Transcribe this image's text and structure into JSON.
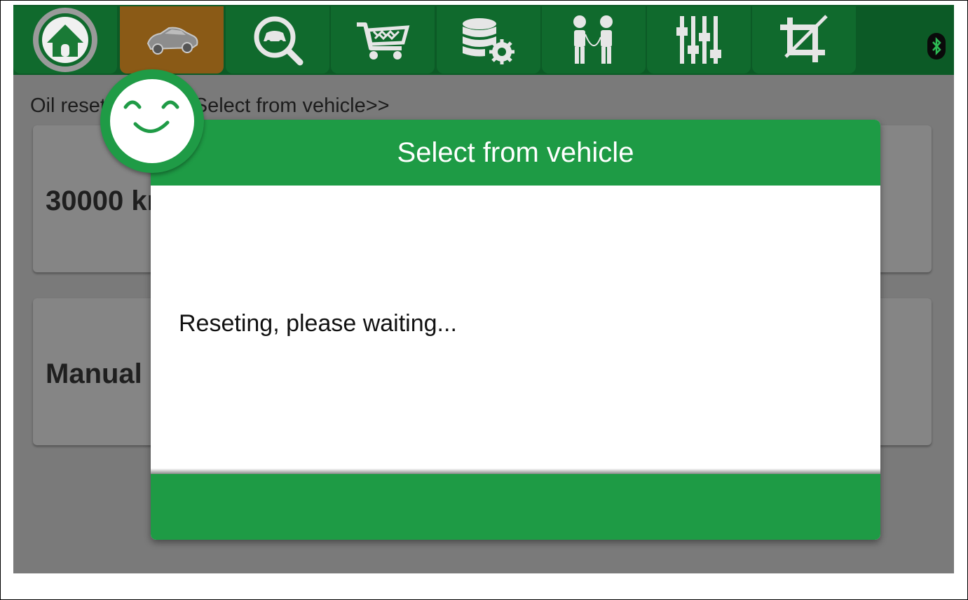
{
  "topbar": {
    "tabs": [
      {
        "icon": "home-icon",
        "active": false
      },
      {
        "icon": "car-icon",
        "active": true
      },
      {
        "icon": "car-search-icon",
        "active": false
      },
      {
        "icon": "shopping-cart-icon",
        "active": false
      },
      {
        "icon": "database-settings-icon",
        "active": false
      },
      {
        "icon": "people-connect-icon",
        "active": false
      },
      {
        "icon": "sliders-icon",
        "active": false
      },
      {
        "icon": "crop-icon",
        "active": false
      }
    ],
    "status_icon": "bluetooth-icon"
  },
  "breadcrumb": "Oil reset>>Audi>>Select from vehicle>>",
  "cards": [
    {
      "label": "30000 km"
    },
    {
      "label": "Manual"
    }
  ],
  "dialog": {
    "title": "Select from vehicle",
    "message": "Reseting, please waiting..."
  },
  "colors": {
    "topbar": "#0c5a26",
    "tab": "#106a2d",
    "active_tab": "#8a5a16",
    "dialog_green": "#1e9b45",
    "overlay_bg": "#7a7a7a"
  }
}
